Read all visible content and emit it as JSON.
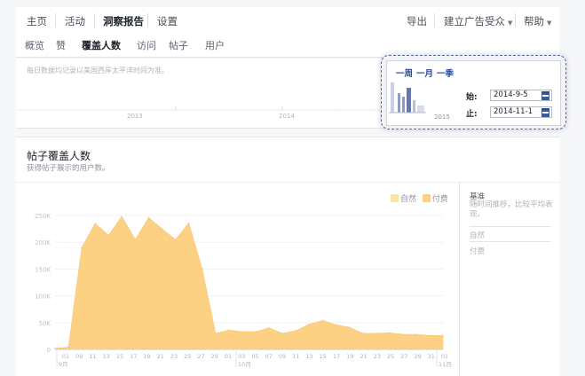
{
  "topnav": {
    "home": "主页",
    "activity": "活动",
    "insights": "洞察报告",
    "settings": "设置",
    "export": "导出",
    "create_ad": "建立广告受众",
    "help": "帮助"
  },
  "subnav": {
    "tabs": [
      "概览",
      "赞",
      "覆盖人数",
      "访问",
      "帖子",
      "用户"
    ]
  },
  "timeline": {
    "note": "每日数据均记录以美国西岸太平洋时间为准。",
    "years": [
      "2013",
      "2014"
    ]
  },
  "popup": {
    "ranges": [
      "一周",
      "一月",
      "一季"
    ],
    "start_label": "始:",
    "start_value": "2014-9-5",
    "end_label": "止:",
    "end_value": "2014-11-1",
    "mini_year": "2015"
  },
  "panel": {
    "title": "帖子覆盖人数",
    "subtitle": "获得帖子展示的用户数。"
  },
  "sidebar": {
    "benchmark": "基准",
    "benchmark_desc": "随时间推移，比较平均表现。",
    "organic": "自然",
    "paid": "付费"
  },
  "colors": {
    "organic": "#ffe3a1",
    "paid": "#fdd183",
    "popup_border": "#5a6a9a"
  },
  "chart_data": {
    "type": "area",
    "legend": [
      "自然",
      "付费"
    ],
    "legend_position": "top-right",
    "ylim": [
      0,
      250000
    ],
    "yticks": [
      "250K",
      "200K",
      "150K",
      "100K",
      "50K",
      "0"
    ],
    "x_month_labels": [
      "9月",
      "10月",
      "11月"
    ],
    "x": [
      "09-05",
      "09-07",
      "09-09",
      "09-11",
      "09-13",
      "09-15",
      "09-17",
      "09-19",
      "09-21",
      "09-23",
      "09-25",
      "09-27",
      "09-29",
      "10-01",
      "10-03",
      "10-05",
      "10-07",
      "10-09",
      "10-11",
      "10-13",
      "10-15",
      "10-17",
      "10-19",
      "10-21",
      "10-23",
      "10-25",
      "10-27",
      "10-29",
      "10-31",
      "11-01"
    ],
    "x_tick_labels": [
      "01",
      "09",
      "11",
      "13",
      "15",
      "17",
      "19",
      "21",
      "23",
      "25",
      "27",
      "29",
      "01",
      "03",
      "05",
      "07",
      "09",
      "11",
      "13",
      "15",
      "17",
      "19",
      "21",
      "23",
      "25",
      "27",
      "29",
      "31",
      "01"
    ],
    "values": [
      2000,
      4000,
      190000,
      235000,
      213000,
      248000,
      205000,
      246000,
      225000,
      205000,
      236000,
      150000,
      30000,
      36000,
      33000,
      33000,
      40000,
      30000,
      35000,
      47000,
      54000,
      46000,
      41000,
      30000,
      30000,
      31000,
      28000,
      28000,
      26000,
      26000
    ]
  }
}
